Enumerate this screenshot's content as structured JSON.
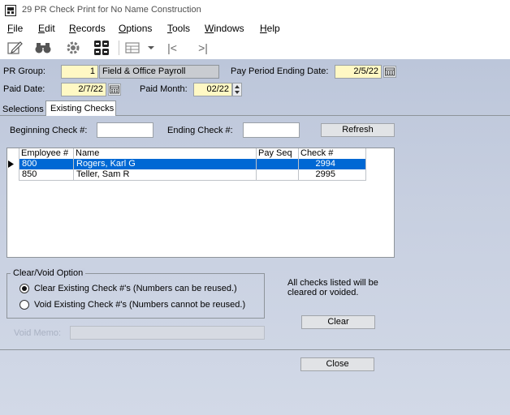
{
  "window": {
    "title": "29 PR Check Print for No Name Construction"
  },
  "menu": {
    "items": [
      {
        "underline": "F",
        "rest": "ile"
      },
      {
        "underline": "E",
        "rest": "dit"
      },
      {
        "underline": "R",
        "rest": "ecords"
      },
      {
        "underline": "O",
        "rest": "ptions"
      },
      {
        "underline": "T",
        "rest": "ools"
      },
      {
        "underline": "W",
        "rest": "indows"
      },
      {
        "underline": "H",
        "rest": "elp"
      }
    ]
  },
  "toolbar": {
    "icons": [
      "edit-icon",
      "binoculars-icon",
      "gear-icon",
      "grid-icon",
      "table-dropdown-icon",
      "first-record-icon",
      "last-record-icon"
    ],
    "first_glyph": "|<",
    "last_glyph": ">|"
  },
  "header": {
    "pr_group_label": "PR Group:",
    "pr_group_value": "1",
    "pr_group_name": "Field & Office Payroll",
    "period_end_label": "Pay Period Ending Date:",
    "period_end_value": "2/5/22",
    "paid_date_label": "Paid Date:",
    "paid_date_value": "2/7/22",
    "paid_month_label": "Paid Month:",
    "paid_month_value": "02/22"
  },
  "tabs": {
    "selections": "Selections",
    "existing_checks": "Existing Checks",
    "active": "existing_checks"
  },
  "range": {
    "begin_label": "Beginning Check #:",
    "begin_value": "",
    "end_label": "Ending Check #:",
    "end_value": "",
    "refresh_label": "Refresh"
  },
  "grid": {
    "columns": [
      "Employee #",
      "Name",
      "Pay Seq",
      "Check #"
    ],
    "rows": [
      {
        "employee": "800",
        "name": "Rogers, Karl G",
        "pay_seq": "",
        "check": "2994",
        "selected": true
      },
      {
        "employee": "850",
        "name": "Teller, Sam R",
        "pay_seq": "",
        "check": "2995",
        "selected": false
      }
    ]
  },
  "clear_void": {
    "group_label": "Clear/Void Option",
    "option_clear": "Clear Existing Check #'s  (Numbers can be reused.)",
    "option_void": "Void Existing Check #'s  (Numbers cannot be reused.)",
    "selected": "clear",
    "note": "All checks listed will be cleared or voided.",
    "clear_button": "Clear",
    "void_memo_label": "Void Memo:",
    "void_memo_value": ""
  },
  "footer": {
    "close_button": "Close"
  },
  "colors": {
    "selection": "#0068d4",
    "field_yellow": "#fff8c4",
    "form_background": "#c7cfe0"
  }
}
